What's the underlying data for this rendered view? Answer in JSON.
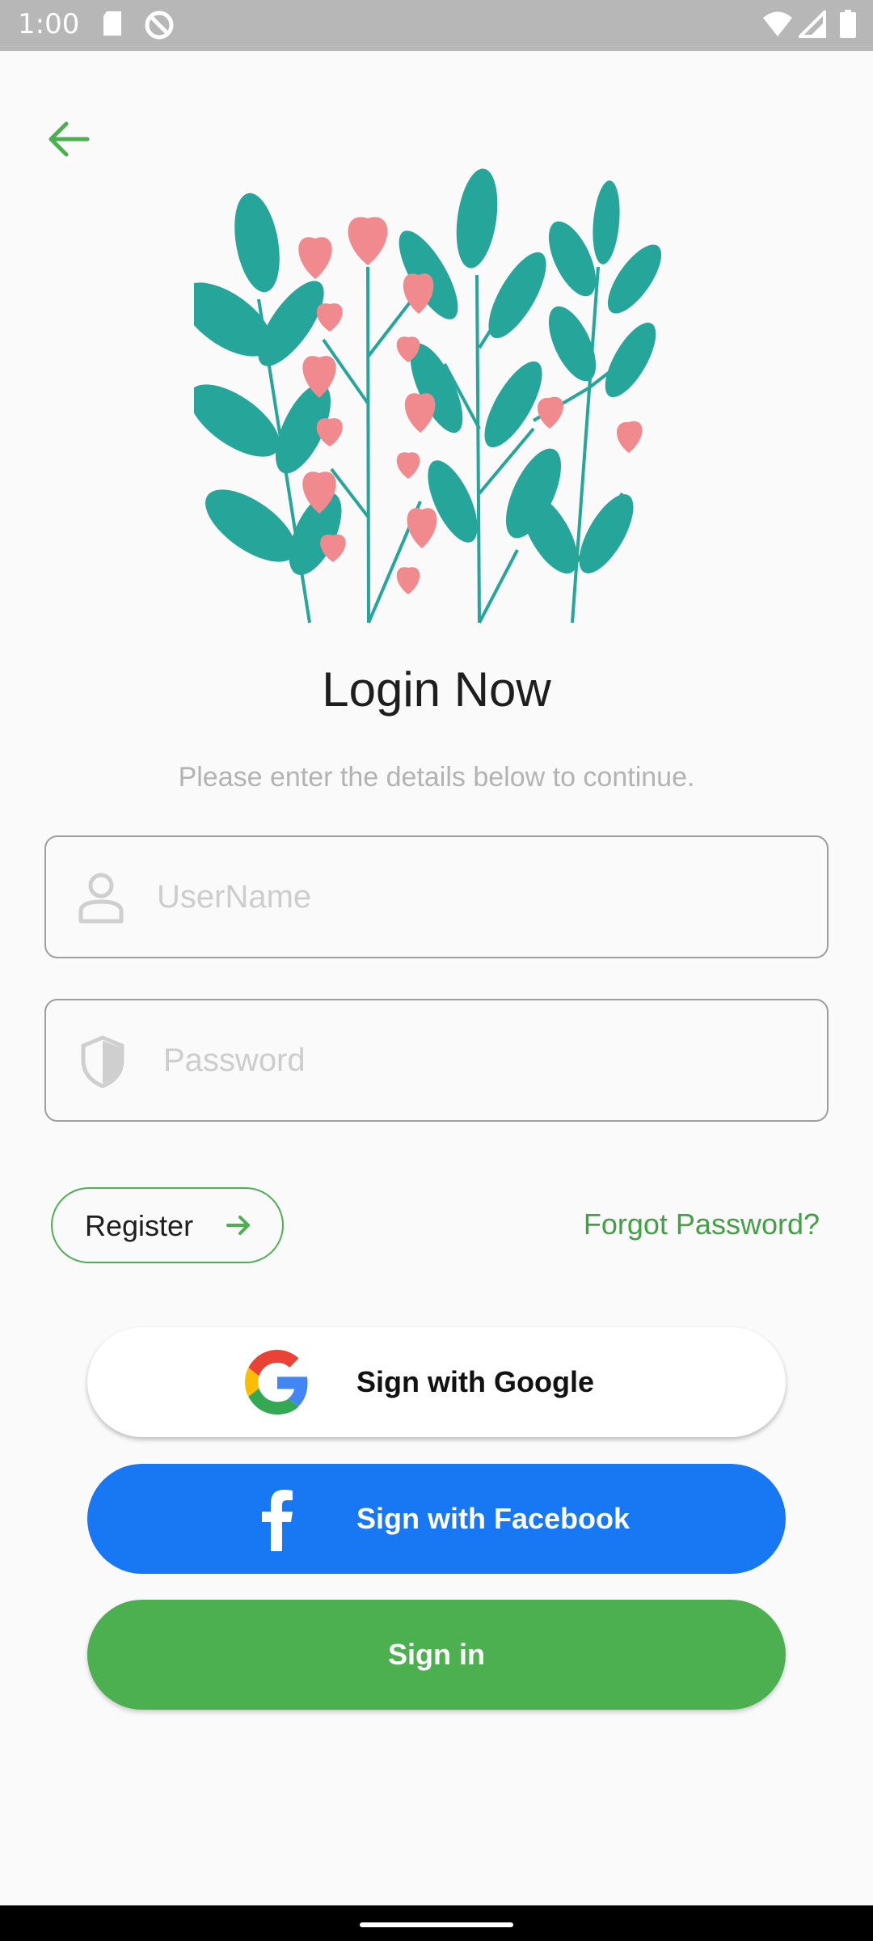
{
  "status_bar": {
    "time": "1:00"
  },
  "icons": {
    "back": "arrow-left-icon",
    "illustration": "flowers-illustration",
    "user": "person-icon",
    "password": "shield-icon",
    "register_arrow": "arrow-right-icon",
    "google": "google-logo-icon",
    "facebook": "facebook-logo-icon"
  },
  "header": {
    "title": "Login Now",
    "subtitle": "Please enter the details below to continue."
  },
  "form": {
    "username": {
      "placeholder": "UserName",
      "value": ""
    },
    "password": {
      "placeholder": "Password",
      "value": ""
    }
  },
  "actions": {
    "register_label": "Register",
    "forgot_label": "Forgot Password?",
    "google_label": "Sign with Google",
    "facebook_label": "Sign with Facebook",
    "signin_label": "Sign in"
  },
  "colors": {
    "accent": "#4caf50",
    "facebook": "#1877f2",
    "leaf": "#26a69a",
    "flower": "#f08a8f"
  }
}
